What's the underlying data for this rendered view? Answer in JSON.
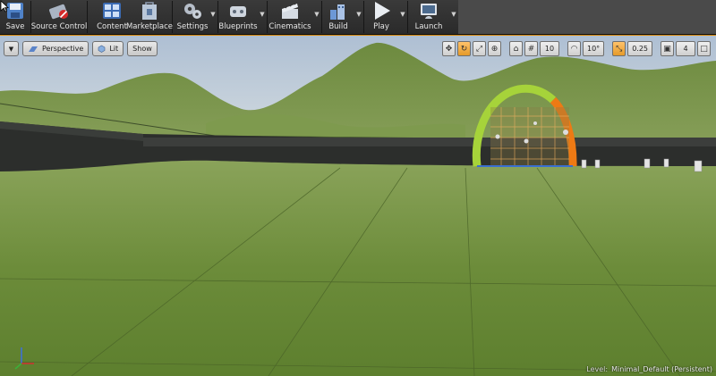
{
  "toolbar": {
    "buttons": [
      {
        "id": "save",
        "label": "Save",
        "icon": "save-icon"
      },
      {
        "id": "source_control",
        "label": "Source Control",
        "icon": "source-control-icon"
      },
      {
        "id": "content",
        "label": "Content",
        "icon": "content-browser-icon"
      },
      {
        "id": "marketplace",
        "label": "Marketplace",
        "icon": "marketplace-icon"
      },
      {
        "id": "settings",
        "label": "Settings",
        "icon": "settings-icon"
      },
      {
        "id": "blueprints",
        "label": "Blueprints",
        "icon": "blueprints-icon"
      },
      {
        "id": "cinematics",
        "label": "Cinematics",
        "icon": "cinematics-icon"
      },
      {
        "id": "build",
        "label": "Build",
        "icon": "build-icon"
      },
      {
        "id": "play",
        "label": "Play",
        "icon": "play-icon"
      },
      {
        "id": "launch",
        "label": "Launch",
        "icon": "launch-icon"
      }
    ],
    "dropdown_glyph": "▼"
  },
  "viewport": {
    "options_glyph": "▼",
    "view_mode": "Perspective",
    "lit": "Lit",
    "show": "Show",
    "grid_snap_value": "10",
    "rotation_snap_value": "10°",
    "scale_snap_value": "0.25",
    "camera_speed_value": "4",
    "level_prefix": "Level:",
    "level_name": "Minimal_Default (Persistent)"
  },
  "colors": {
    "toolbar_bg": "#2f2f2f",
    "accent_orange": "#e59a2a",
    "sky_top": "#b9cde1",
    "grass": "#6a8a37",
    "arc_green": "#9ed22a",
    "arc_orange": "#ef7a14"
  }
}
